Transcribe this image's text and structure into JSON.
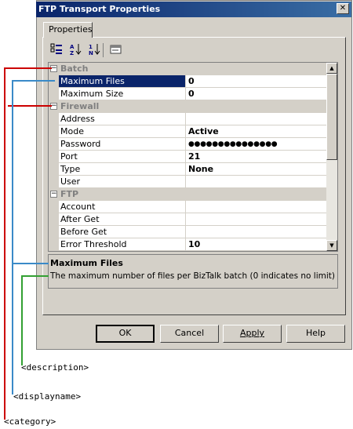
{
  "window": {
    "title": "FTP Transport Properties",
    "close_glyph": "✕"
  },
  "tab": {
    "label": "Properties"
  },
  "toolbar": {
    "icons": [
      "categorized-icon",
      "sort-alphabetical-icon",
      "sort-az-icon",
      "property-pages-icon"
    ]
  },
  "grid": {
    "categories": [
      {
        "name": "Batch",
        "toggle": "−"
      },
      {
        "name": "Firewall",
        "toggle": "−"
      },
      {
        "name": "FTP",
        "toggle": "−"
      }
    ],
    "rows": {
      "max_files": {
        "name": "Maximum Files",
        "value": "0"
      },
      "max_size": {
        "name": "Maximum Size",
        "value": "0"
      },
      "address": {
        "name": "Address",
        "value": ""
      },
      "mode": {
        "name": "Mode",
        "value": "Active"
      },
      "password": {
        "name": "Password",
        "value": "●●●●●●●●●●●●●●●"
      },
      "port": {
        "name": "Port",
        "value": "21"
      },
      "type": {
        "name": "Type",
        "value": "None"
      },
      "user": {
        "name": "User",
        "value": ""
      },
      "account": {
        "name": "Account",
        "value": ""
      },
      "after_get": {
        "name": "After Get",
        "value": ""
      },
      "before_get": {
        "name": "Before Get",
        "value": ""
      },
      "error_threshold": {
        "name": "Error Threshold",
        "value": "10"
      }
    }
  },
  "description": {
    "title": "Maximum Files",
    "text": "The maximum number of files per BizTalk batch (0 indicates no limit)"
  },
  "buttons": {
    "ok": "OK",
    "cancel": "Cancel",
    "apply": "Apply",
    "help": "Help"
  },
  "annotations": {
    "description": "<description>",
    "displayname": "<displayname>",
    "category": "<category>"
  },
  "colors": {
    "category_line": "#cc0000",
    "displayname_line": "#3a8ac8",
    "description_line": "#33a033",
    "selection": "#0a246a"
  }
}
